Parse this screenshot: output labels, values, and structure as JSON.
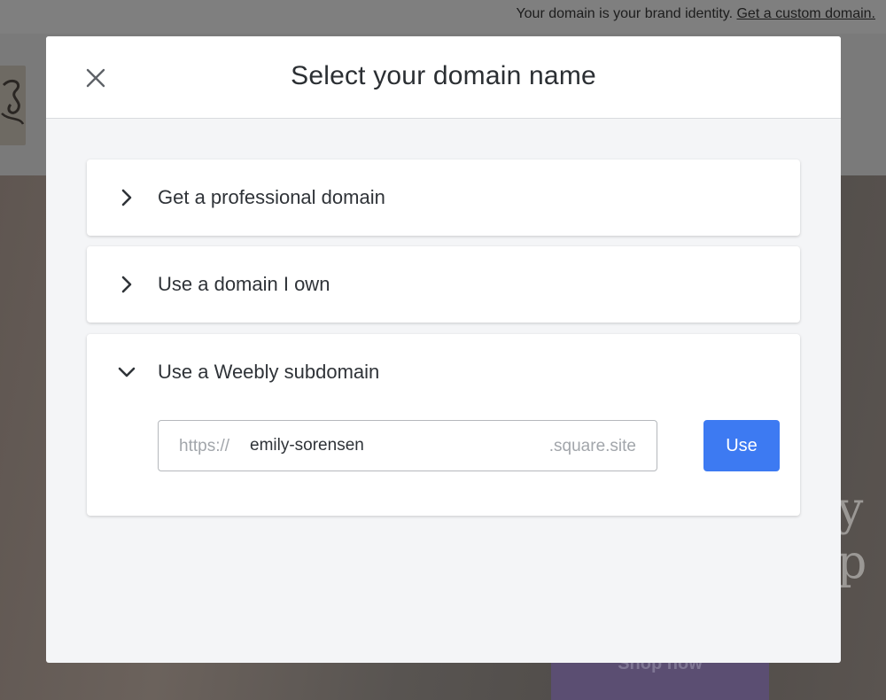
{
  "background_page": {
    "topbar": {
      "message": "Your domain is your brand identity.",
      "link_label": "Get a custom domain."
    },
    "hero_text_fragment": "y p",
    "shop_button_label": "Shop now"
  },
  "modal": {
    "title": "Select your domain name",
    "close_icon": "close-icon",
    "panels": [
      {
        "label": "Get a professional domain",
        "expanded": false,
        "icon": "chevron-right-icon"
      },
      {
        "label": "Use a domain I own",
        "expanded": false,
        "icon": "chevron-right-icon"
      },
      {
        "label": "Use a Weebly subdomain",
        "expanded": true,
        "icon": "chevron-down-icon"
      }
    ],
    "subdomain": {
      "prefix": "https://",
      "value": "emily-sorensen",
      "suffix": ".square.site",
      "use_button_label": "Use"
    }
  },
  "colors": {
    "primary_button": "#3d7af2",
    "modal_body": "#f4f5f7",
    "title_text": "#2b2f33"
  }
}
